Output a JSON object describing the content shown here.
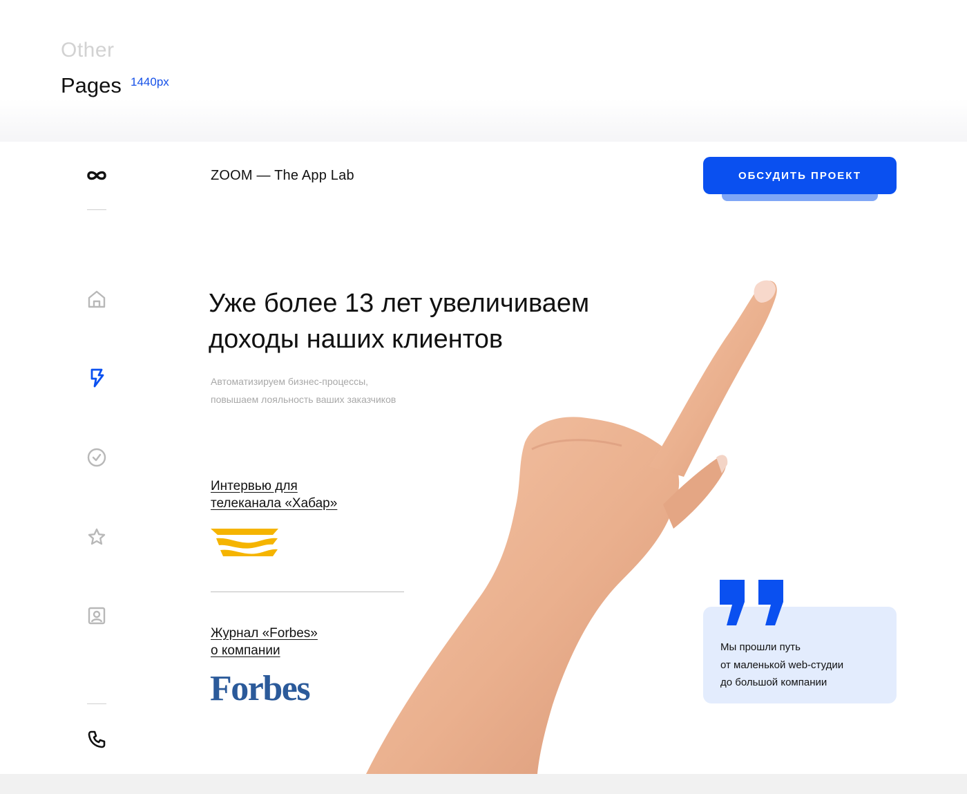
{
  "showcase": {
    "label_other": "Other",
    "label_pages": "Pages",
    "label_width": "1440px"
  },
  "header": {
    "brand": "ZOOM — The App Lab",
    "cta_label": "ОБСУДИТЬ ПРОЕКТ"
  },
  "sidebar": {
    "items": [
      {
        "icon": "logo-infinity-icon"
      },
      {
        "icon": "home-icon"
      },
      {
        "icon": "lightning-icon",
        "active": true
      },
      {
        "icon": "check-circle-icon"
      },
      {
        "icon": "star-icon"
      },
      {
        "icon": "contact-card-icon"
      },
      {
        "icon": "phone-icon"
      }
    ]
  },
  "hero": {
    "title": "Уже более 13 лет увеличиваем\nдоходы наших клиентов",
    "subtitle": "Автоматизируем бизнес-процессы,\nповышаем лояльность ваших заказчиков"
  },
  "press": {
    "items": [
      {
        "link": "Интервью для\nтелеканала «Хабар»",
        "logo": "khabar-logo"
      },
      {
        "link": "Журнал «Forbes»\nо компании",
        "logo": "Forbes"
      }
    ]
  },
  "quote": {
    "text": "Мы прошли путь\nот маленькой web-студии\nдо большой компании"
  },
  "colors": {
    "accent": "#0a50f0",
    "accent_light": "#e3ecfd",
    "khabar_yellow": "#f5b400",
    "forbes_blue": "#2b5a9a",
    "muted_text": "#a8a8a8"
  }
}
